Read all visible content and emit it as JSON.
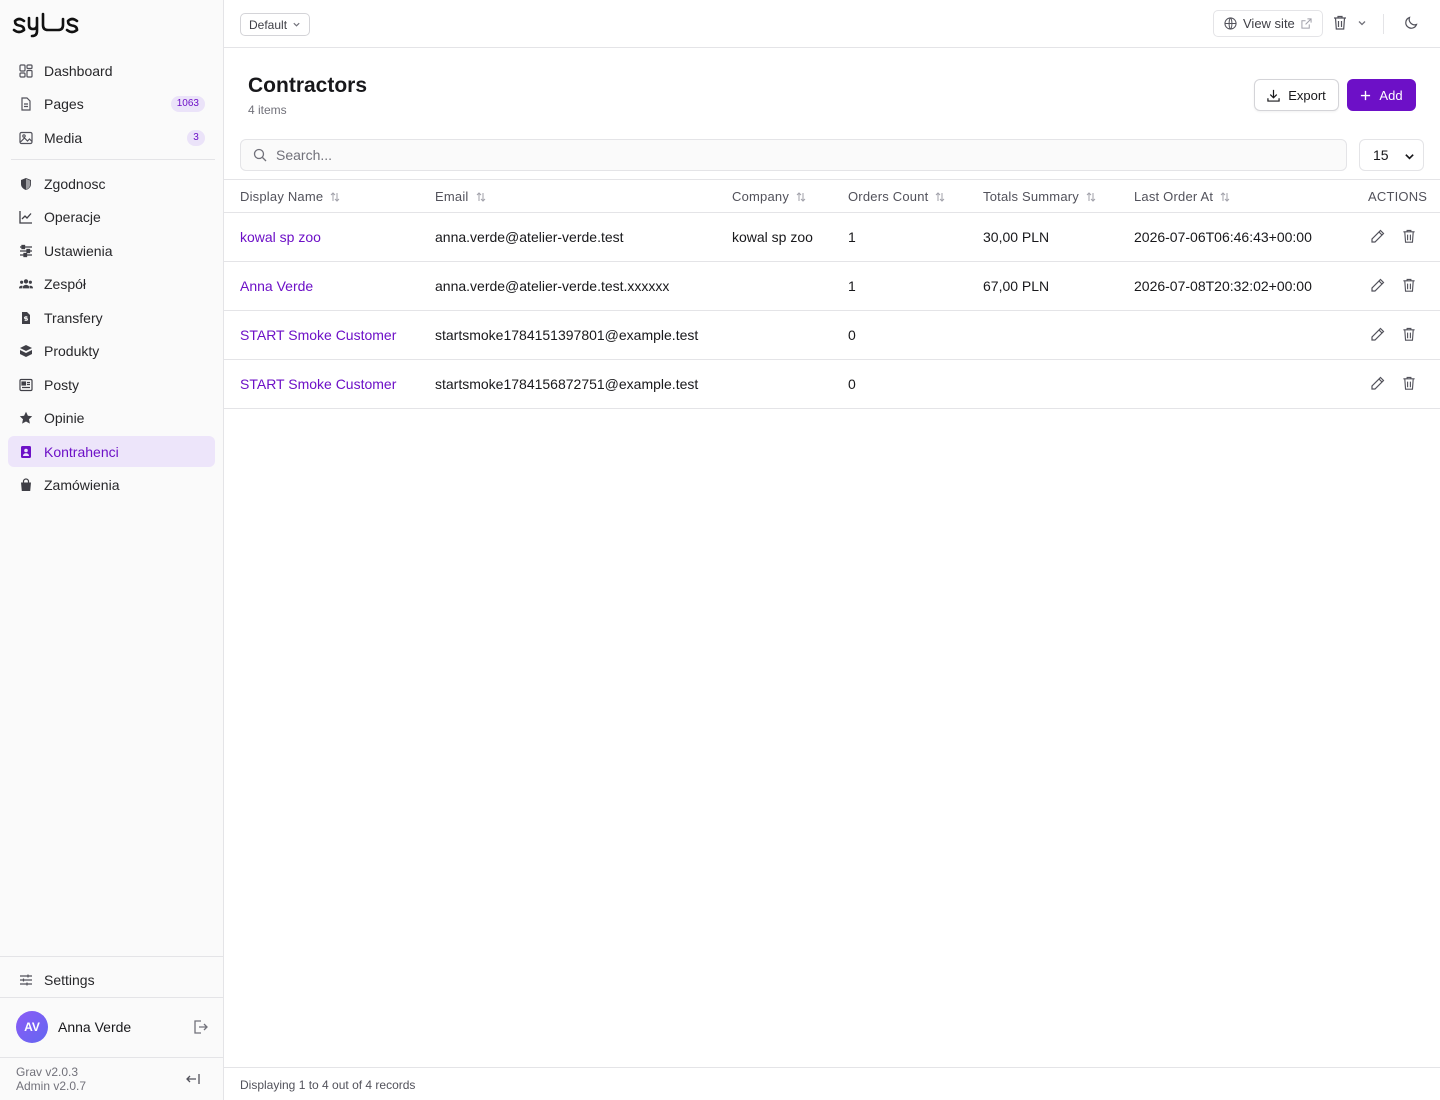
{
  "sidebar": {
    "logo_text": "syls",
    "items": [
      {
        "label": "Dashboard",
        "icon": "dashboard-icon"
      },
      {
        "label": "Pages",
        "icon": "pages-icon",
        "badge": "1063"
      },
      {
        "label": "Media",
        "icon": "media-icon",
        "badge": "3"
      },
      {
        "label": "Zgodnosc",
        "icon": "shield-icon"
      },
      {
        "label": "Operacje",
        "icon": "chart-line-icon"
      },
      {
        "label": "Ustawienia",
        "icon": "sliders-icon"
      },
      {
        "label": "Zespół",
        "icon": "users-icon"
      },
      {
        "label": "Transfery",
        "icon": "file-dollar-icon"
      },
      {
        "label": "Produkty",
        "icon": "box-icon"
      },
      {
        "label": "Posty",
        "icon": "newspaper-icon"
      },
      {
        "label": "Opinie",
        "icon": "star-icon"
      },
      {
        "label": "Kontrahenci",
        "icon": "contact-icon",
        "active": true
      },
      {
        "label": "Zamówienia",
        "icon": "bag-icon"
      }
    ],
    "settings_label": "Settings",
    "user": {
      "initials": "AV",
      "name": "Anna Verde"
    },
    "versions": {
      "grav": "Grav v2.0.3",
      "admin": "Admin v2.0.7"
    }
  },
  "topbar": {
    "environment": "Default",
    "view_site": "View site"
  },
  "page": {
    "title": "Contractors",
    "count": "4 items",
    "export_label": "Export",
    "add_label": "Add",
    "search_placeholder": "Search...",
    "per_page": "15"
  },
  "table": {
    "columns": [
      "Display Name",
      "Email",
      "Company",
      "Orders Count",
      "Totals Summary",
      "Last Order At",
      "ACTIONS"
    ],
    "rows": [
      {
        "name": "kowal sp zoo",
        "email": "anna.verde@atelier-verde.test",
        "company": "kowal sp zoo",
        "orders": "1",
        "totals": "30,00 PLN",
        "last_order": "2026-07-06T06:46:43+00:00"
      },
      {
        "name": "Anna Verde",
        "email": "anna.verde@atelier-verde.test.xxxxxx",
        "company": "",
        "orders": "1",
        "totals": "67,00 PLN",
        "last_order": "2026-07-08T20:32:02+00:00"
      },
      {
        "name": "START Smoke Customer",
        "email": "startsmoke1784151397801@example.test",
        "company": "",
        "orders": "0",
        "totals": "",
        "last_order": ""
      },
      {
        "name": "START Smoke Customer",
        "email": "startsmoke1784156872751@example.test",
        "company": "",
        "orders": "0",
        "totals": "",
        "last_order": ""
      }
    ]
  },
  "footer": {
    "text": "Displaying 1 to 4 out of 4 records"
  },
  "colors": {
    "accent": "#6d10c7",
    "active_bg": "#ede5fa",
    "border": "#e4e4e7"
  }
}
